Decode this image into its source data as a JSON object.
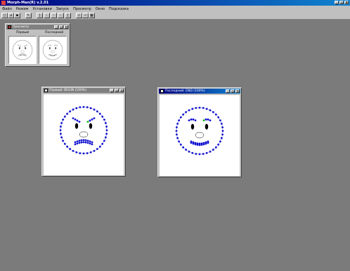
{
  "app": {
    "title": "Morph-Man(R) v.2.01"
  },
  "menu": [
    "Файл",
    "Режим",
    "Установки",
    "Запуск",
    "Просмотр",
    "Окно",
    "Подсказка"
  ],
  "toolbar": {
    "buttons": [
      "new-icon",
      "open-icon",
      "save-icon",
      "arrow-icon",
      "frame-first-icon",
      "frame-prev-icon",
      "frame-mark-icon",
      "frame-next-icon",
      "frame-last-icon",
      "zoom-icon",
      "zoom-out-icon",
      "grid-icon"
    ]
  },
  "preview_window": {
    "title": "Просмотр",
    "labels": [
      "Первый",
      "Последний"
    ]
  },
  "first_window": {
    "title": "Первый: BEGIN (100%)"
  },
  "last_window": {
    "title": "Последний: END (100%)"
  },
  "colors": {
    "titlebar_active": "#000080",
    "point": "#1010d0",
    "point_selected": "#00c000",
    "desktop": "#7b7b7b"
  },
  "faces": {
    "first": {
      "mood": "angry"
    },
    "last": {
      "mood": "happy"
    }
  }
}
